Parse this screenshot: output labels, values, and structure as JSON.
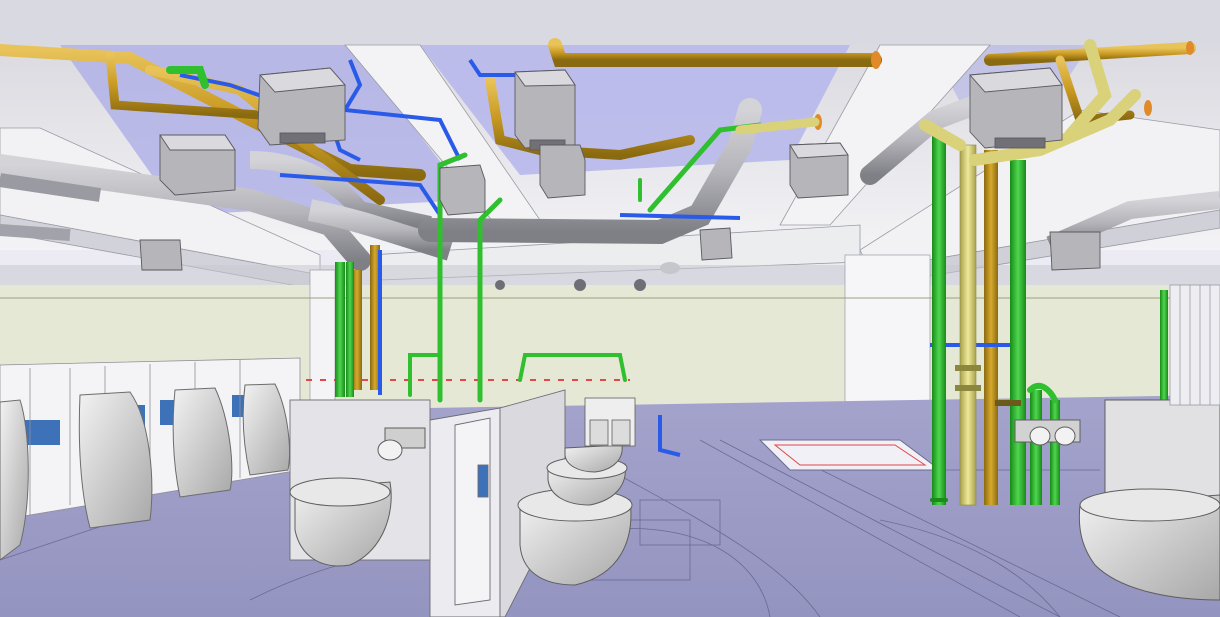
{
  "scene": {
    "colors": {
      "ceiling": "#f1f1f4",
      "ceiling_shadow": "#d9d9e2",
      "ceiling_recess": "#a9a9e6",
      "back_wall": "#e8ead8",
      "floor": "#9c9cc6",
      "floor_line": "#5e5e86",
      "beam": "#efeff2",
      "beam_side": "#d0d0d8",
      "duct": "#b7b7bd",
      "duct_dark": "#8a8a92",
      "pipe_gold": "#c99a22",
      "pipe_green": "#2fbf2f",
      "pipe_blue": "#2a5be8",
      "pipe_yellow": "#d9d27a",
      "fixture": "#dcdcdc",
      "fixture_dark": "#a9a9a9",
      "partition_blue": "#3d72b8"
    },
    "fixtures": {
      "wall_toilets": 4,
      "urinals": 4,
      "floor_drain": 1
    }
  }
}
